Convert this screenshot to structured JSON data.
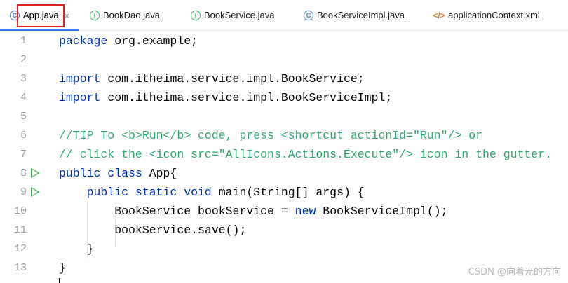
{
  "tabs": [
    {
      "label": "App.java",
      "icon": "class-icon",
      "active": true
    },
    {
      "label": "BookDao.java",
      "icon": "interface-icon"
    },
    {
      "label": "BookService.java",
      "icon": "interface-icon"
    },
    {
      "label": "BookServiceImpl.java",
      "icon": "class-icon"
    },
    {
      "label": "applicationContext.xml",
      "icon": "xml-icon"
    }
  ],
  "tab_close_glyph": "×",
  "colors": {
    "accent": "#3574f0",
    "highlight": "#e02020",
    "keyword": "#0033b3",
    "comment": "#2eaa6e",
    "run": "#3fa756"
  },
  "editor": {
    "lines": [
      {
        "num": "1",
        "kw": "package",
        "rest": " org.example;"
      },
      {
        "num": "2",
        "text": ""
      },
      {
        "num": "3",
        "kw": "import",
        "rest": " com.itheima.service.impl.BookService;"
      },
      {
        "num": "4",
        "kw": "import",
        "rest": " com.itheima.service.impl.BookServiceImpl;"
      },
      {
        "num": "5",
        "text": ""
      },
      {
        "num": "6",
        "comment": "//TIP To <b>Run</b> code, press <shortcut actionId=\"Run\"/> or"
      },
      {
        "num": "7",
        "comment": "// click the <icon src=\"AllIcons.Actions.Execute\"/> icon in the gutter."
      },
      {
        "num": "8",
        "kw": "public class",
        "rest": " App{",
        "run": true
      },
      {
        "num": "9",
        "indent": "    ",
        "kw": "public static void",
        "rest": " main(String[] args) {",
        "run": true
      },
      {
        "num": "10",
        "indent": "        ",
        "pre": "BookService bookService = ",
        "kw": "new",
        "rest": " BookServiceImpl();"
      },
      {
        "num": "11",
        "indent": "        ",
        "text": "bookService.save();"
      },
      {
        "num": "12",
        "indent": "    ",
        "text": "}"
      },
      {
        "num": "13",
        "text": "}"
      }
    ]
  },
  "watermark": "CSDN @向着光的方向"
}
